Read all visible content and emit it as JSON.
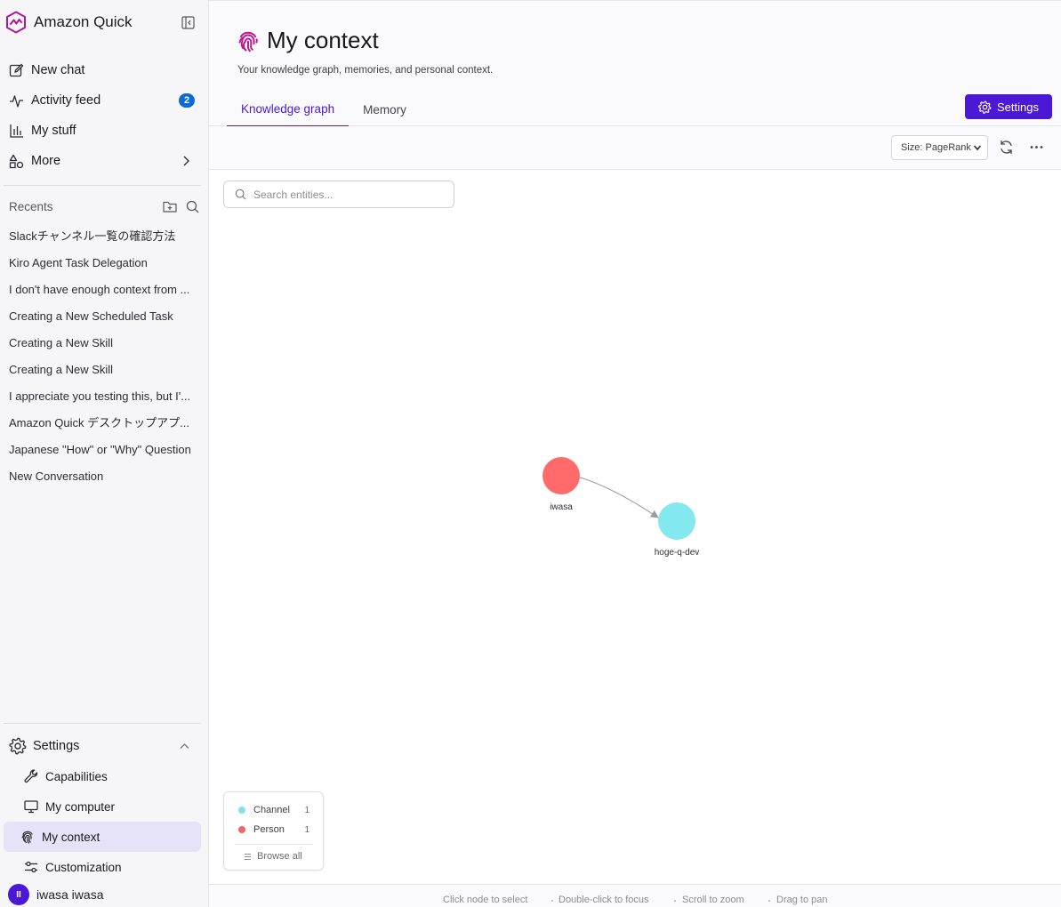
{
  "app": {
    "name": "Amazon Quick"
  },
  "nav": {
    "new_chat": "New chat",
    "activity_feed": "Activity feed",
    "activity_badge": "2",
    "my_stuff": "My stuff",
    "more": "More"
  },
  "recents": {
    "title": "Recents",
    "items": [
      "Slackチャンネル一覧の確認方法",
      "Kiro Agent Task Delegation",
      "I don't have enough context from ...",
      "Creating a New Scheduled Task",
      "Creating a New Skill",
      "Creating a New Skill",
      "I appreciate you testing this, but I'...",
      "Amazon Quick デスクトップアプ...",
      "Japanese \"How\" or \"Why\" Question",
      "New Conversation"
    ]
  },
  "settings_menu": {
    "title": "Settings",
    "items": [
      "Capabilities",
      "My computer",
      "My context",
      "Customization"
    ]
  },
  "user": {
    "initials": "II",
    "name": "iwasa iwasa"
  },
  "page": {
    "title": "My context",
    "subtitle": "Your knowledge graph, memories, and personal context.",
    "tabs": [
      "Knowledge graph",
      "Memory"
    ],
    "settings_button": "Settings"
  },
  "toolbar": {
    "size_select": "Size: PageRank"
  },
  "search": {
    "placeholder": "Search entities..."
  },
  "graph": {
    "nodes": [
      {
        "label": "iwasa",
        "type": "Person",
        "color": "#ff6b6b"
      },
      {
        "label": "hoge-q-dev",
        "type": "Channel",
        "color": "#84e9ee"
      }
    ],
    "edges": [
      {
        "from": "iwasa",
        "to": "hoge-q-dev"
      }
    ]
  },
  "legend": {
    "items": [
      {
        "label": "Channel",
        "count": "1",
        "color": "#7ce3e8"
      },
      {
        "label": "Person",
        "count": "1",
        "color": "#f26466"
      }
    ],
    "browse_all": "Browse all"
  },
  "hints": [
    "Click node to select",
    "Double-click to focus",
    "Scroll to zoom",
    "Drag to pan"
  ],
  "colors": {
    "accent": "#4b18d6",
    "badge": "#0a6bd6",
    "active_bg": "#e6e2f7"
  }
}
